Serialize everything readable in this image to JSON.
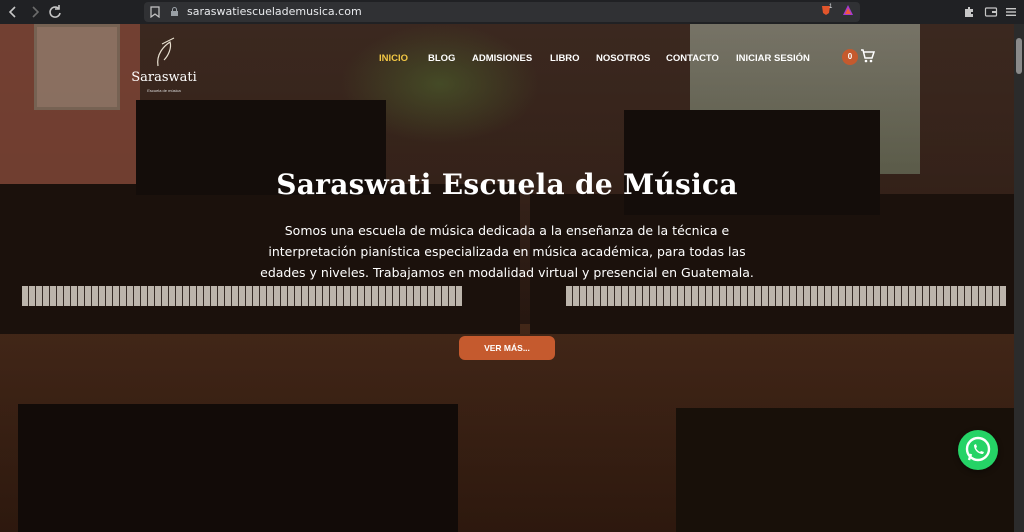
{
  "browser": {
    "url": "saraswatiescueladem​usica.com",
    "brave_shield_count": "1"
  },
  "site": {
    "logo_name": "Saraswati",
    "logo_tagline": "Escuela de música",
    "menu": [
      {
        "label": "INICIO",
        "active": true
      },
      {
        "label": "BLOG"
      },
      {
        "label": "ADMISIONES"
      },
      {
        "label": "LIBRO"
      },
      {
        "label": "NOSOTROS"
      },
      {
        "label": "CONTACTO"
      },
      {
        "label": "INICIAR SESIÓN"
      }
    ],
    "cart_count": "0",
    "accent_color": "#c55a2e",
    "active_color": "#f2c744"
  },
  "hero": {
    "title": "Saraswati Escuela de Música",
    "text": "Somos una escuela de música dedicada a la enseñanza de la técnica e interpretación pianística especializada en música académica, para todas las edades y niveles. Trabajamos en modalidad virtual y presencial en Guatemala.",
    "cta_label": "VER MÁS..."
  }
}
